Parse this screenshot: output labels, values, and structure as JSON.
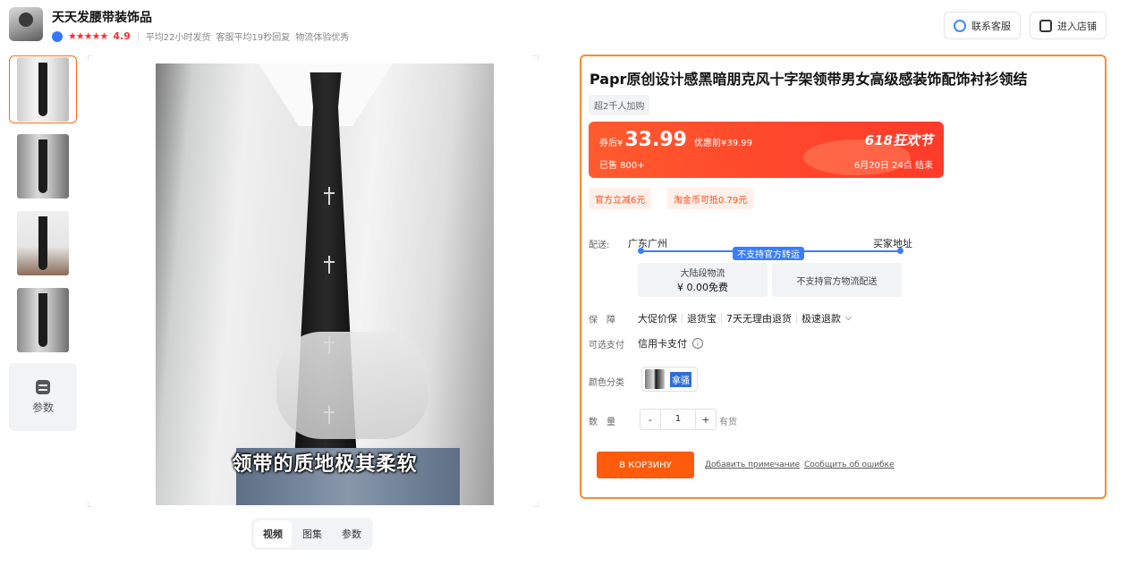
{
  "shop": {
    "name": "天天发腰带装饰品",
    "rating_stars": "★★★★★",
    "rating": "4.9",
    "meta": [
      "平均22小时发货",
      "客服平均19秒回复",
      "物流体验优秀"
    ]
  },
  "header_buttons": {
    "service": "联系客服",
    "store": "进入店铺"
  },
  "thumbnails": {
    "params_label": "参数"
  },
  "image": {
    "caption": "领带的质地极其柔软"
  },
  "media_tabs": [
    "视频",
    "图集",
    "参数"
  ],
  "product": {
    "title": "Papr原创设计感黑暗朋克风十字架领带男女高级感装饰配饰衬衫领结",
    "sold_tag": "超2千人加购",
    "price": {
      "prefix": "券后¥",
      "value": "33.99",
      "before": "优惠前¥39.99",
      "sold": "已售 800+",
      "event": "618狂欢节",
      "end": "6月20日 24点 结束"
    },
    "coupons": [
      "官方立减6元",
      "淘金币可抵0.79元"
    ],
    "shipping": {
      "label": "配送:",
      "from": "广东广州",
      "to": "买家地址",
      "notice": "不支持官方转运",
      "card1_title": "大陆段物流",
      "card1_fee": "¥ 0.00免费",
      "card2_title": "不支持官方物流配送"
    },
    "guarantee": {
      "label": "保　障",
      "items": [
        "大促价保",
        "退货宝",
        "7天无理由退货",
        "极速退款"
      ]
    },
    "payment": {
      "label": "可选支付",
      "value": "信用卡支付",
      "info": "i"
    },
    "color": {
      "label": "颜色分类",
      "option": "拿骚"
    },
    "quantity": {
      "label": "数　量",
      "minus": "-",
      "value": "1",
      "plus": "+",
      "stock": "有货"
    },
    "cart_button": "В КОРЗИНУ",
    "links": [
      "Добавить примечание",
      "Сообщить об ошибке"
    ]
  }
}
